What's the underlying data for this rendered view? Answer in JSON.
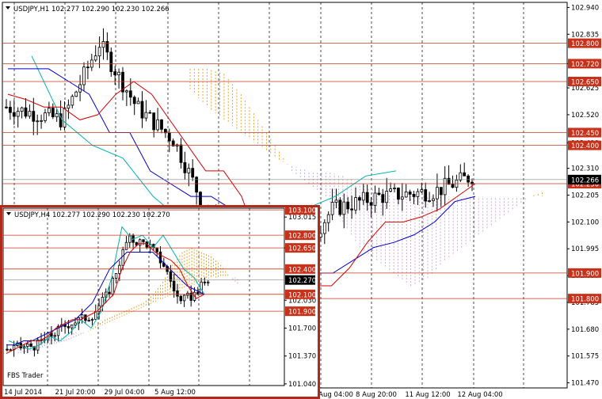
{
  "colors": {
    "bg": "#ffffff",
    "grid": "#000000",
    "candle": "#000000",
    "tenkan": "#d40000",
    "kijun": "#0000cc",
    "chikou": "#00b3b3",
    "kumo_up": "#e39a1b",
    "kumo_down": "#c9a3d6",
    "level_line": "#c43a1e",
    "level_tag": "#c8321a",
    "price_tag": "#000000"
  },
  "chart_data": [
    {
      "type": "candlestick",
      "symbol": "USDJPY,H1",
      "header": "USDJPY,H1  102.277 102.290 102.230 102.266",
      "ylim": [
        101.45,
        102.96
      ],
      "y_ticks": [
        "102.940",
        "102.835",
        "102.720",
        "102.625",
        "102.520",
        "102.410",
        "102.310",
        "102.205",
        "102.100",
        "101.995",
        "101.890",
        "101.785",
        "101.680",
        "101.575",
        "101.470"
      ],
      "x_ticks": [
        "8 Aug 04:00",
        "8 Aug 20:00",
        "11 Aug 12:00",
        "12 Aug 04:00"
      ],
      "levels": [
        102.8,
        102.72,
        102.65,
        102.45,
        102.4,
        102.25,
        101.9,
        101.8
      ],
      "level_labels": [
        "102.800",
        "102.720",
        "102.650",
        "102.450",
        "102.400",
        "102.250",
        "101.900",
        "101.800"
      ],
      "current_price": "102.266",
      "tenkan": [
        102.6,
        102.58,
        102.55,
        102.55,
        102.5,
        102.52,
        102.6,
        102.65,
        102.6,
        102.5,
        102.4,
        102.3,
        102.3,
        102.2,
        102.0,
        101.95,
        101.9,
        101.85,
        101.85,
        101.92,
        102.02,
        102.1,
        102.1,
        102.12,
        102.15,
        102.2,
        102.25
      ],
      "kijun": [
        102.7,
        102.7,
        102.7,
        102.65,
        102.6,
        102.45,
        102.45,
        102.3,
        102.25,
        102.2,
        102.2,
        102.15,
        102.1,
        102.0,
        101.95,
        101.9,
        101.9,
        101.95,
        102.0,
        102.02,
        102.05,
        102.1,
        102.18,
        102.2
      ],
      "chikou": [
        102.75,
        102.5,
        102.4,
        102.35,
        102.2,
        102.1,
        101.95,
        102.0,
        102.1,
        102.15,
        102.2,
        102.28,
        102.3
      ],
      "kumo_a": [
        102.7,
        102.7,
        102.68,
        102.6,
        102.5,
        102.4,
        102.3,
        102.25,
        102.2,
        102.1,
        102.0,
        101.95,
        101.9,
        101.85,
        101.88,
        101.95,
        102.0,
        102.05,
        102.1,
        102.15,
        102.2,
        102.22
      ],
      "kumo_b": [
        102.62,
        102.55,
        102.5,
        102.45,
        102.4,
        102.35,
        102.32,
        102.3,
        102.3,
        102.28,
        102.25,
        102.22,
        102.2,
        102.2,
        102.2,
        102.2,
        102.2,
        102.2,
        102.2,
        102.2,
        102.2,
        102.2
      ]
    },
    {
      "type": "candlestick",
      "symbol": "USDJPY,H4",
      "header": "USDJPY,H4  102.277 102.290 102.230 102.270",
      "ylim": [
        101.02,
        103.12
      ],
      "y_ticks": [
        "103.015",
        "102.650",
        "102.030",
        "101.700",
        "101.370",
        "101.040"
      ],
      "x_ticks": [
        "14 Jul 2014",
        "21 Jul 20:00",
        "29 Jul 04:00",
        "5 Aug 12:00"
      ],
      "levels": [
        103.1,
        102.8,
        102.65,
        102.4,
        102.1,
        101.9
      ],
      "level_labels": [
        "103.100",
        "102.800",
        "102.650",
        "102.400",
        "102.100",
        "101.900"
      ],
      "current_price": "102.270",
      "watermark": "FBS Trader",
      "tenkan": [
        101.4,
        101.45,
        101.5,
        101.55,
        101.55,
        101.6,
        101.7,
        101.75,
        101.8,
        101.8,
        101.85,
        101.9,
        102.0,
        102.1,
        102.4,
        102.6,
        102.7,
        102.7,
        102.6,
        102.55,
        102.5,
        102.4,
        102.2,
        102.05,
        102.1
      ],
      "kijun": [
        101.5,
        101.5,
        101.55,
        101.55,
        101.6,
        101.65,
        101.7,
        101.75,
        101.8,
        101.9,
        102.0,
        102.2,
        102.4,
        102.5,
        102.6,
        102.6,
        102.6,
        102.6,
        102.5,
        102.4,
        102.3,
        102.2,
        102.15,
        102.1
      ],
      "chikou": [
        101.55,
        101.5,
        101.45,
        101.5,
        101.6,
        101.55,
        101.65,
        101.8,
        101.7,
        101.9,
        102.3,
        102.9,
        102.75,
        102.8,
        102.65,
        102.8,
        102.6,
        102.4,
        102.3,
        102.1
      ],
      "kumo_a": [
        101.4,
        101.42,
        101.45,
        101.5,
        101.52,
        101.55,
        101.6,
        101.65,
        101.72,
        101.8,
        101.85,
        101.9,
        101.95,
        102.0,
        102.1,
        102.25,
        102.45,
        102.6,
        102.65,
        102.6,
        102.55,
        102.45,
        102.3,
        102.2
      ],
      "kumo_b": [
        101.55,
        101.55,
        101.55,
        101.6,
        101.6,
        101.6,
        101.65,
        101.65,
        101.7,
        101.75,
        101.8,
        101.85,
        101.9,
        101.95,
        102.0,
        102.05,
        102.1,
        102.15,
        102.2,
        102.25,
        102.3,
        102.3,
        102.3,
        102.3
      ]
    }
  ]
}
